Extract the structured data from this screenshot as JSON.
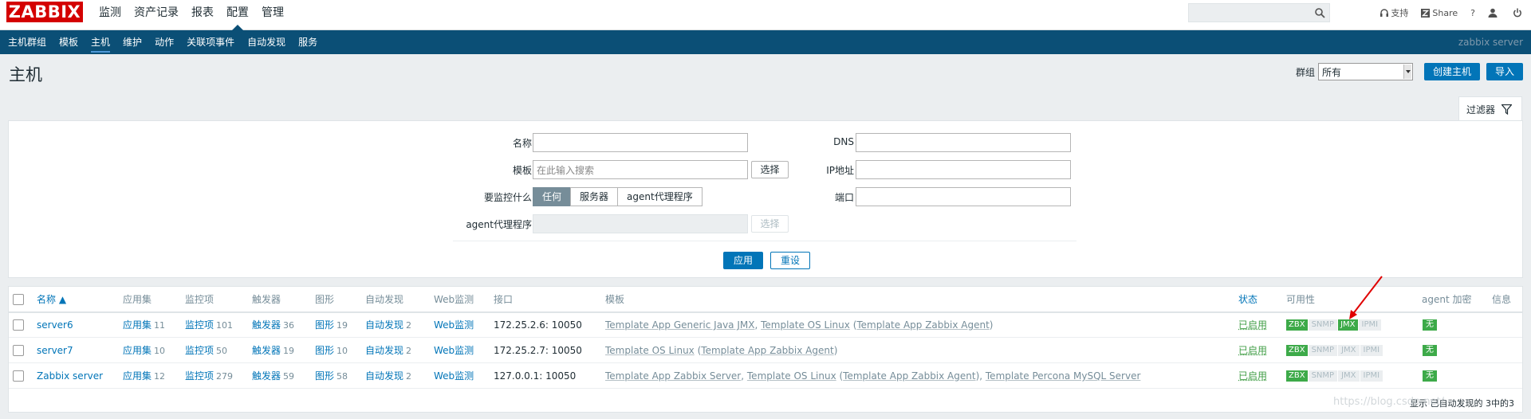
{
  "app": {
    "logo": "ZABBIX"
  },
  "topnav": {
    "items": [
      "监测",
      "资产记录",
      "报表",
      "配置",
      "管理"
    ],
    "active": 3,
    "support_label": "支持",
    "share_label": "Share",
    "help_label": "?"
  },
  "subnav": {
    "items": [
      "主机群组",
      "模板",
      "主机",
      "维护",
      "动作",
      "关联项事件",
      "自动发现",
      "服务"
    ],
    "active": 2,
    "server_name": "zabbix server"
  },
  "page": {
    "title": "主机",
    "group_label": "群组",
    "group_value": "所有",
    "create_button": "创建主机",
    "import_button": "导入"
  },
  "filter": {
    "tab_label": "过滤器",
    "name_label": "名称",
    "template_label": "模板",
    "template_placeholder": "在此输入搜索",
    "select_button": "选择",
    "monitored_by_label": "要监控什么",
    "monitored_by_options": [
      "任何",
      "服务器",
      "agent代理程序"
    ],
    "monitored_by_active": 0,
    "proxy_label": "agent代理程序",
    "proxy_select_button": "选择",
    "dns_label": "DNS",
    "ip_label": "IP地址",
    "port_label": "端口",
    "apply_button": "应用",
    "reset_button": "重设"
  },
  "table": {
    "headers": {
      "name": "名称 ▲",
      "applications": "应用集",
      "items": "监控项",
      "triggers": "触发器",
      "graphs": "图形",
      "discovery": "自动发现",
      "web": "Web监测",
      "interface": "接口",
      "templates": "模板",
      "status": "状态",
      "availability": "可用性",
      "encryption": "agent 加密",
      "info": "信息"
    },
    "rows": [
      {
        "name": "server6",
        "applications": "应用集",
        "applications_count": "11",
        "items": "监控项",
        "items_count": "101",
        "triggers": "触发器",
        "triggers_count": "36",
        "graphs": "图形",
        "graphs_count": "19",
        "discovery": "自动发现",
        "discovery_count": "2",
        "web": "Web监测",
        "interface": "172.25.2.6: 10050",
        "templates_a": "Template App Generic Java JMX",
        "templates_b": "Template OS Linux",
        "templates_c": "Template App Zabbix Agent",
        "templates_d": "",
        "status": "已启用",
        "zbx": "ZBX",
        "snmp": "SNMP",
        "jmx": "JMX",
        "ipmi": "IPMI",
        "jmx_green": true,
        "encryption": "无"
      },
      {
        "name": "server7",
        "applications": "应用集",
        "applications_count": "10",
        "items": "监控项",
        "items_count": "50",
        "triggers": "触发器",
        "triggers_count": "19",
        "graphs": "图形",
        "graphs_count": "10",
        "discovery": "自动发现",
        "discovery_count": "2",
        "web": "Web监测",
        "interface": "172.25.2.7: 10050",
        "templates_a": "Template OS Linux",
        "templates_b": "",
        "templates_c": "Template App Zabbix Agent",
        "templates_d": "",
        "status": "已启用",
        "zbx": "ZBX",
        "snmp": "SNMP",
        "jmx": "JMX",
        "ipmi": "IPMI",
        "jmx_green": false,
        "encryption": "无"
      },
      {
        "name": "Zabbix server",
        "applications": "应用集",
        "applications_count": "12",
        "items": "监控项",
        "items_count": "279",
        "triggers": "触发器",
        "triggers_count": "59",
        "graphs": "图形",
        "graphs_count": "58",
        "discovery": "自动发现",
        "discovery_count": "2",
        "web": "Web监测",
        "interface": "127.0.0.1: 10050",
        "templates_a": "Template App Zabbix Server",
        "templates_b": "Template OS Linux",
        "templates_c": "Template App Zabbix Agent",
        "templates_d": "Template Percona MySQL Server",
        "status": "已启用",
        "zbx": "ZBX",
        "snmp": "SNMP",
        "jmx": "JMX",
        "ipmi": "IPMI",
        "jmx_green": false,
        "encryption": "无"
      }
    ],
    "footer": "显示 已自动发现的 3中的3"
  },
  "watermark": "https://blog.csdn.net/",
  "colors": {
    "brand_red": "#d40000",
    "nav_blue": "#0b4f76",
    "link_blue": "#0275b8",
    "green": "#3daa49"
  }
}
